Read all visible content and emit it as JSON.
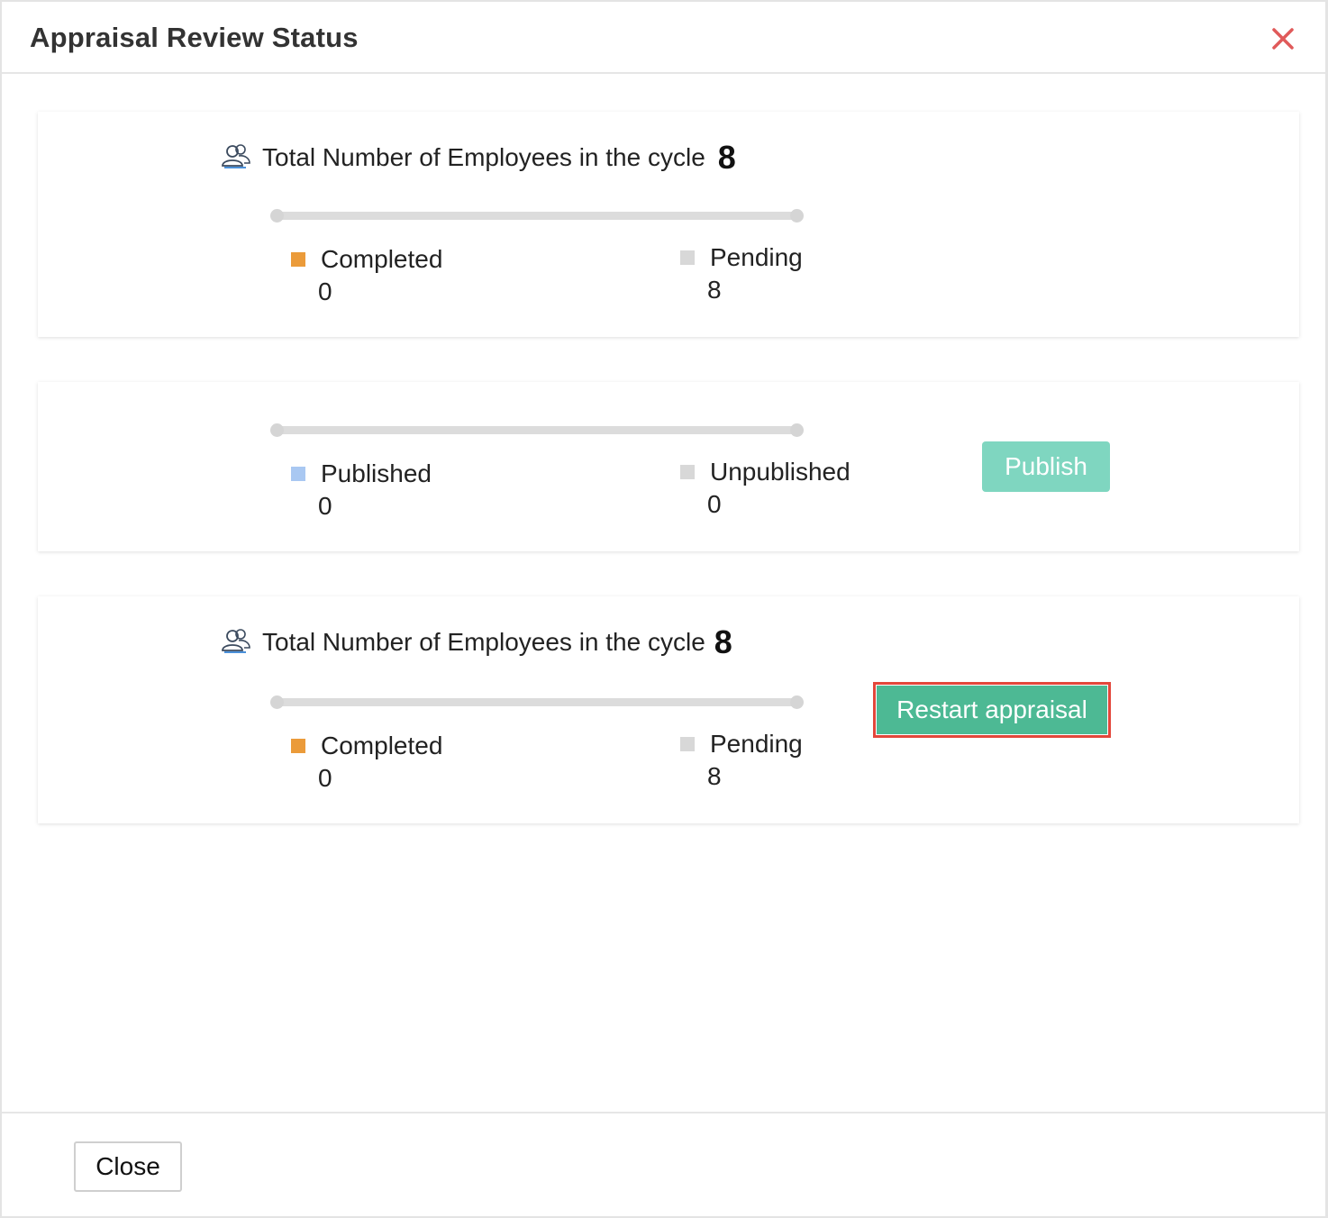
{
  "dialog": {
    "title": "Appraisal Review Status",
    "close_icon": "close-x-icon",
    "accent_colors": {
      "close": "#e05a5a",
      "completed": "#eb9b3a",
      "pending": "#d8d8d8",
      "published": "#a9c8f2",
      "unpublished": "#d8d8d8",
      "publish_button": "#7fd6c0",
      "restart_button": "#4db994",
      "highlight_border": "#e3473b"
    }
  },
  "review_card": {
    "icon": "users-icon",
    "total_label": "Total Number of Employees in the cycle",
    "total_value": "8",
    "progress_fraction": 0,
    "completed": {
      "label": "Completed",
      "value": "0"
    },
    "pending": {
      "label": "Pending",
      "value": "8"
    }
  },
  "publish_card": {
    "progress_fraction": 0,
    "published": {
      "label": "Published",
      "value": "0"
    },
    "unpublished": {
      "label": "Unpublished",
      "value": "0"
    },
    "publish_button": "Publish"
  },
  "restart_card": {
    "icon": "users-icon",
    "total_label": "Total Number of Employees in the cycle",
    "total_value": "8",
    "progress_fraction": 0,
    "completed": {
      "label": "Completed",
      "value": "0"
    },
    "pending": {
      "label": "Pending",
      "value": "8"
    },
    "restart_button": "Restart appraisal"
  },
  "footer": {
    "close_button": "Close"
  }
}
